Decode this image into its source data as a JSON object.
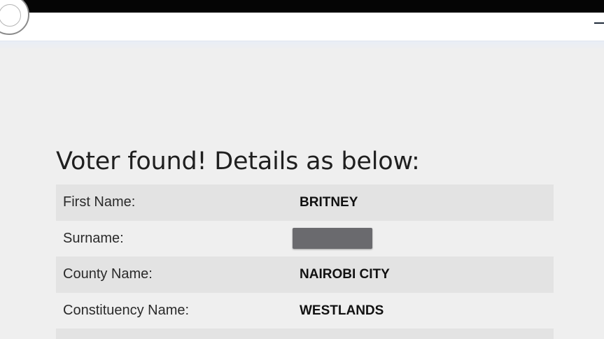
{
  "heading": "Voter found! Details as below:",
  "details": [
    {
      "label": "First Name:",
      "value": "BRITNEY"
    },
    {
      "label": "Surname:",
      "value": ""
    },
    {
      "label": "County Name:",
      "value": "NAIROBI CITY"
    },
    {
      "label": "Constituency Name:",
      "value": "WESTLANDS"
    }
  ],
  "colors": {
    "topbar": "#050505",
    "page_background": "#efefef",
    "stripe_row": "#e3e3e3",
    "redaction": "#6a6a6e"
  },
  "icons": {
    "logo": "circular-emblem-icon"
  }
}
